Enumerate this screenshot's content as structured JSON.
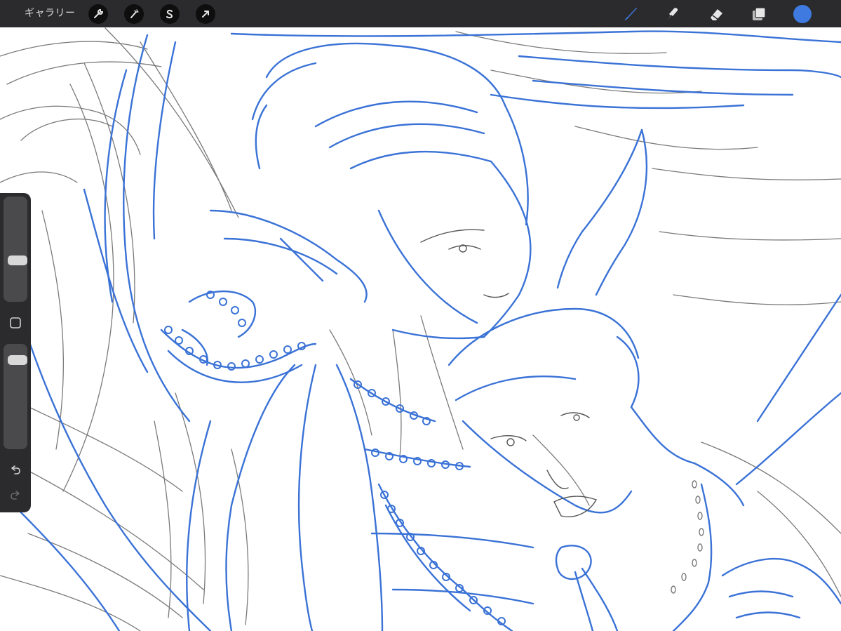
{
  "topbar": {
    "gallery_label": "ギャラリー",
    "left_tools": [
      {
        "name": "actions-wrench-icon"
      },
      {
        "name": "adjustments-magic-wand-icon"
      },
      {
        "name": "selection-s-icon"
      },
      {
        "name": "transform-arrow-icon"
      }
    ],
    "right_tools": [
      {
        "name": "brush-icon",
        "active": true
      },
      {
        "name": "smudge-icon",
        "active": false
      },
      {
        "name": "eraser-icon",
        "active": false
      },
      {
        "name": "layers-icon",
        "active": false
      }
    ],
    "current_color": "#3e7ae0"
  },
  "colors": {
    "bar": "#2b2b2d",
    "accent": "#3e7ae0",
    "sketch_blue": "#3a72d6",
    "sketch_gray": "#6e6e6e"
  },
  "sidebar": {
    "brush_size_level": 0.37,
    "opacity_level": 0.92,
    "buttons": [
      "modify-square-icon",
      "undo-icon",
      "redo-icon"
    ]
  }
}
